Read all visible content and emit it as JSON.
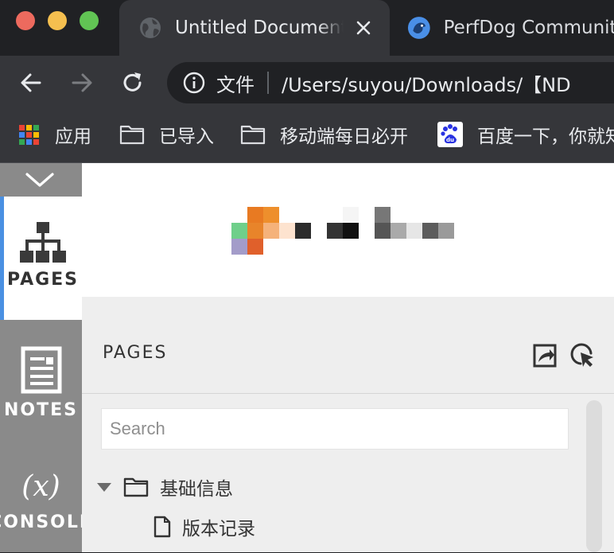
{
  "browser": {
    "tabs": [
      {
        "title": "Untitled Document",
        "active": true,
        "icon": "globe-icon"
      },
      {
        "title": "PerfDog Community",
        "active": false,
        "icon": "perfdog-favicon-icon"
      }
    ],
    "address": {
      "security_label": "文件",
      "url": "/Users/suyou/Downloads/【ND"
    },
    "bookmarks": [
      {
        "label": "应用",
        "icon": "apps-grid-icon"
      },
      {
        "label": "已导入",
        "icon": "folder-icon"
      },
      {
        "label": "移动端每日必开",
        "icon": "folder-icon"
      },
      {
        "label": "百度一下，你就知",
        "icon": "baidu-icon"
      }
    ]
  },
  "rail": {
    "pages_label": "PAGES",
    "notes_label": "NOTES",
    "console_symbol": "(x)",
    "console_label": "CONSOLE"
  },
  "panel": {
    "title": "PAGES",
    "search_placeholder": "Search",
    "tree": [
      {
        "label": "基础信息",
        "type": "folder",
        "expanded": true
      },
      {
        "label": "版本记录",
        "type": "page"
      }
    ]
  },
  "colors": {
    "accent": "#4a90e2",
    "rail_bg": "#8a8a8a",
    "logo_orange": "#e8842a",
    "logo_green": "#6fcf8a"
  }
}
